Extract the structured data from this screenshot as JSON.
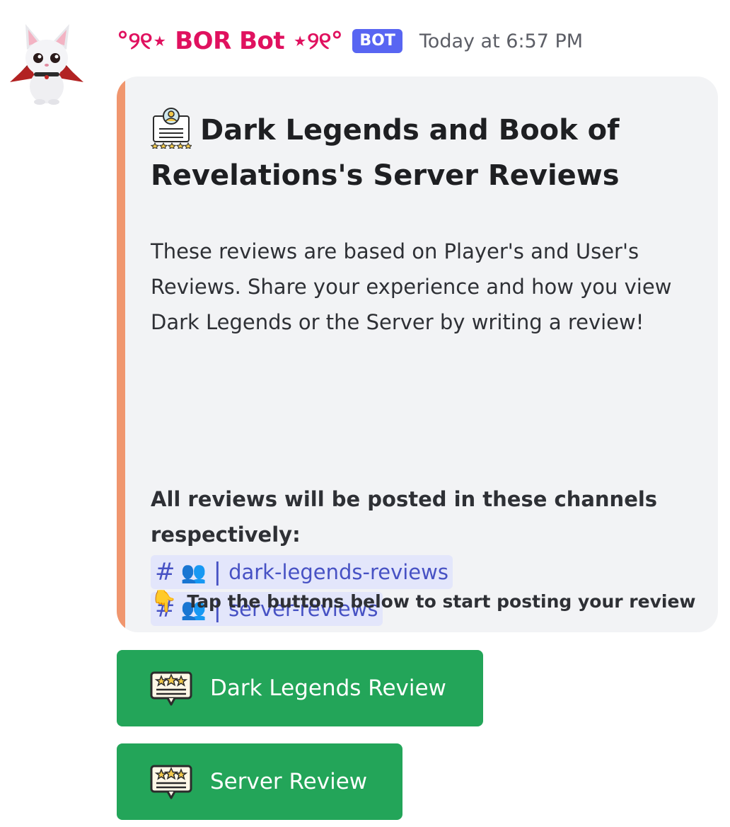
{
  "author": {
    "name": "°୨୧⋆ BOR Bot ⋆୨୧°",
    "tag": "BOT",
    "timestamp": "Today at 6:57 PM",
    "avatar_icon": "bat-mascot-icon"
  },
  "embed": {
    "accent_color": "#f0966e",
    "title_icon": "review-certificate-icon",
    "title": "Dark Legends and Book of Revelations's Server Reviews",
    "description": "These reviews are based on Player's and User's Reviews. Share your experience and how you view Dark Legends or the Server by writing a review!",
    "channels_heading": "All reviews will be posted in these channels respectively:",
    "channels": [
      {
        "hash": "#",
        "emoji": "👥",
        "separator": "|",
        "name": "dark-legends-reviews"
      },
      {
        "hash": "#",
        "emoji": "👥",
        "separator": "|",
        "name": "server-reviews"
      }
    ],
    "footer_emoji": "👇",
    "footer_text": "Tap the buttons below to start posting your review"
  },
  "buttons": [
    {
      "label": "Dark Legends Review",
      "icon": "rating-speech-bubble-icon",
      "color": "#23a559"
    },
    {
      "label": "Server Review",
      "icon": "rating-speech-bubble-icon",
      "color": "#23a559"
    }
  ]
}
